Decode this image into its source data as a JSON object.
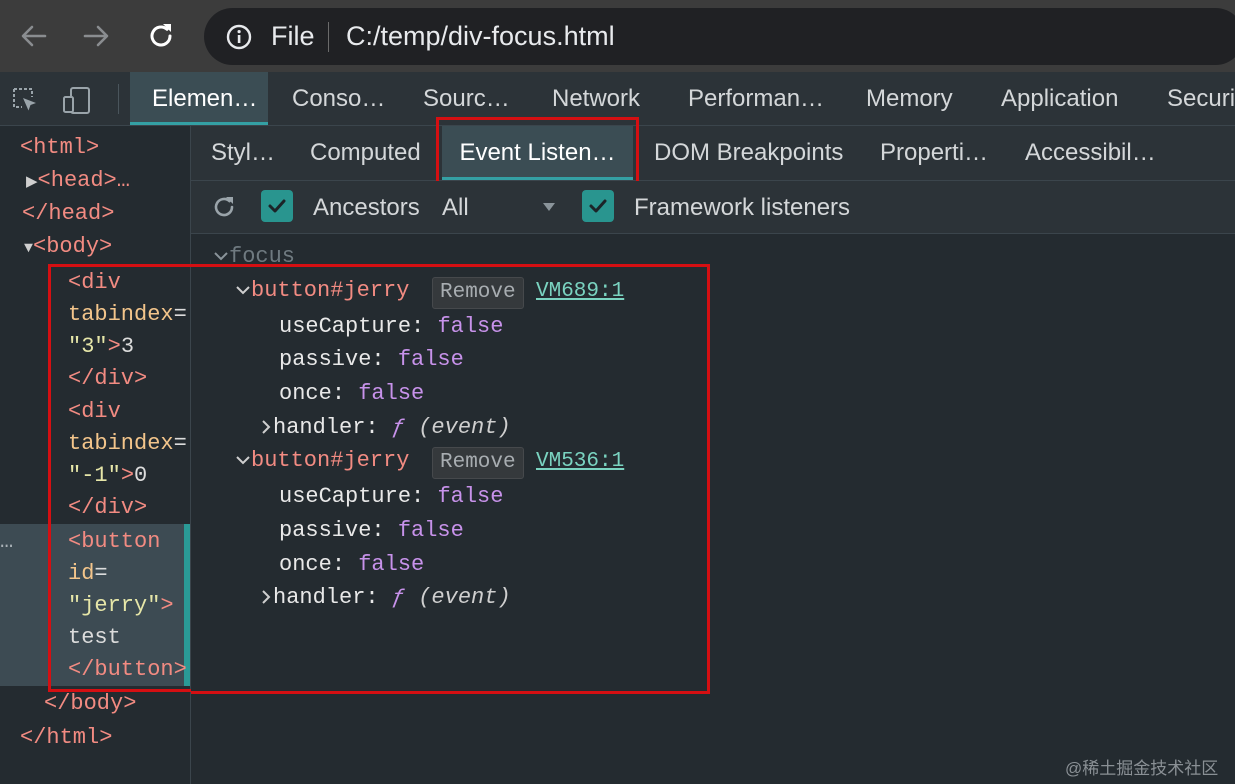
{
  "browser": {
    "protocol_label": "File",
    "url": "C:/temp/div-focus.html",
    "icons": [
      "back-arrow-icon",
      "forward-arrow-icon",
      "reload-icon",
      "info-icon"
    ]
  },
  "devtools": {
    "main_tabs": [
      "Elemen…",
      "Conso…",
      "Sourc…",
      "Network",
      "Performan…",
      "Memory",
      "Application",
      "Securi"
    ],
    "sub_tabs": [
      "Styl…",
      "Computed",
      "Event Listen…",
      "DOM Breakpoints",
      "Properti…",
      "Accessibil…"
    ],
    "toolbar": {
      "ancestors_label": "Ancestors",
      "filter_value": "All",
      "framework_label": "Framework listeners"
    },
    "tree": {
      "html_open": "<html>",
      "head_collapsed": "<head>…",
      "head_close": "</head>",
      "body_open": "<body>",
      "div1_open": "<div",
      "attr_tabindex": "tabindex",
      "eq": "=",
      "div1_val": "\"3\"",
      "div1_close_br": ">",
      "div1_text": "3",
      "div_close": "</div>",
      "div2_open": "<div",
      "div2_val": "\"-1\"",
      "div2_text": "0",
      "button_open": "<button",
      "attr_id": "id",
      "button_val": "\"jerry\"",
      "button_text": "test",
      "button_close": "</button>",
      "body_close": "</body>",
      "html_close": "</html>",
      "ellipsis": "…"
    },
    "listeners": {
      "event": "focus",
      "items": [
        {
          "target": "button#jerry",
          "remove_label": "Remove",
          "source": "VM689:1",
          "useCapture": "false",
          "passive": "false",
          "once": "false",
          "handler_fn": "ƒ",
          "handler_args": "(event)"
        },
        {
          "target": "button#jerry",
          "remove_label": "Remove",
          "source": "VM536:1",
          "useCapture": "false",
          "passive": "false",
          "once": "false",
          "handler_fn": "ƒ",
          "handler_args": "(event)"
        }
      ],
      "keys": {
        "useCapture": "useCapture",
        "passive": "passive",
        "once": "once",
        "handler": "handler",
        "colon": ":"
      }
    }
  },
  "watermark": "@稀土掘金技术社区",
  "colors": {
    "accent": "#34a0a4",
    "highlight": "#d50f12",
    "checkbox": "#29958f"
  }
}
